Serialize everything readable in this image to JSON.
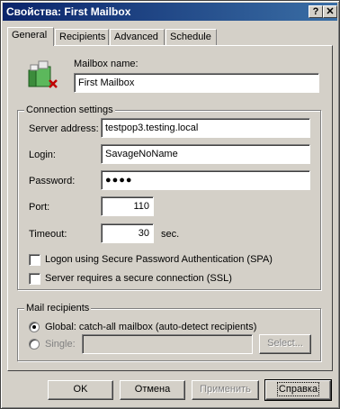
{
  "window": {
    "title": "Свойства: First Mailbox",
    "help_glyph": "?",
    "close_glyph": "✕"
  },
  "tabs": [
    {
      "label": "General",
      "active": true
    },
    {
      "label": "Recipients",
      "active": false
    },
    {
      "label": "Advanced",
      "active": false
    },
    {
      "label": "Schedule",
      "active": false
    }
  ],
  "general": {
    "icon": "mailbox-icon",
    "mailbox_name_label": "Mailbox name:",
    "mailbox_name_value": "First Mailbox"
  },
  "connection": {
    "group_title": "Connection settings",
    "server_label": "Server address:",
    "server_value": "testpop3.testing.local",
    "login_label": "Login:",
    "login_value": "SavageNoName",
    "password_label": "Password:",
    "password_value": "●●●●",
    "port_label": "Port:",
    "port_value": "110",
    "timeout_label": "Timeout:",
    "timeout_value": "30",
    "timeout_unit": "sec.",
    "spa_label": "Logon using Secure Password Authentication (SPA)",
    "spa_checked": false,
    "ssl_label": "Server requires a secure connection (SSL)",
    "ssl_checked": false
  },
  "recipients": {
    "group_title": "Mail recipients",
    "global_label": "Global: catch-all mailbox (auto-detect recipients)",
    "global_selected": true,
    "single_label": "Single:",
    "single_selected": false,
    "single_value": "",
    "select_button": "Select..."
  },
  "buttons": {
    "ok": "OK",
    "cancel": "Отмена",
    "apply": "Применить",
    "help": "Справка"
  },
  "colors": {
    "titlebar_start": "#0a246a",
    "titlebar_end": "#3a6ea5",
    "face": "#d4d0c8"
  }
}
